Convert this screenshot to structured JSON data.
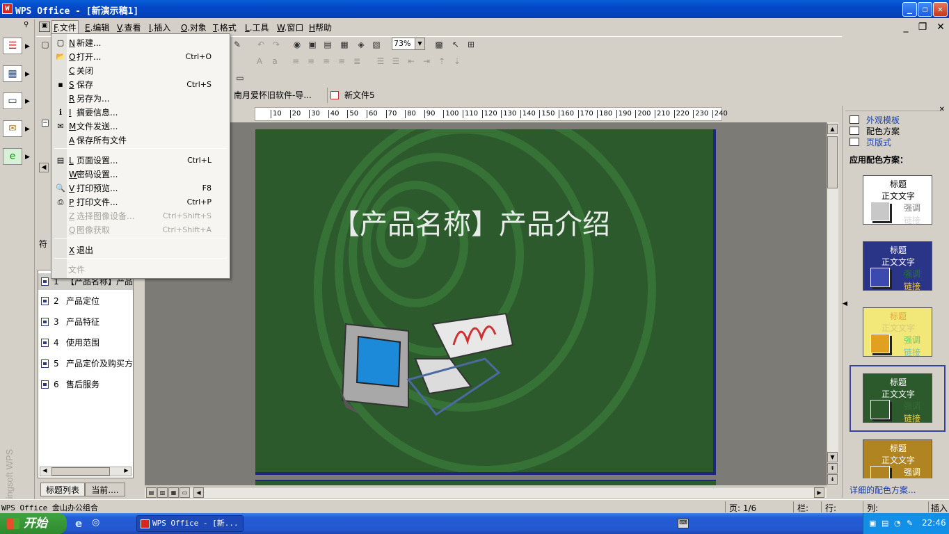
{
  "window": {
    "title": "WPS Office - [新演示稿1]",
    "controls": [
      "minimize",
      "maximize",
      "close"
    ]
  },
  "menubar": {
    "items": [
      {
        "key": "F",
        "label": ".文件"
      },
      {
        "key": "E",
        "label": ".编辑"
      },
      {
        "key": "V",
        "label": ".查看"
      },
      {
        "key": "I",
        "label": ".插入"
      },
      {
        "key": "O",
        "label": ".对象"
      },
      {
        "key": "T",
        "label": ".格式"
      },
      {
        "key": "L",
        "label": ".工具"
      },
      {
        "key": "W",
        "label": ".窗口"
      },
      {
        "key": "H",
        "label": "帮助"
      }
    ]
  },
  "file_menu": {
    "items": [
      {
        "key": "N",
        "label": "新建...",
        "shortcut": "",
        "icon": "new-file-icon"
      },
      {
        "key": "O",
        "label": "打开...",
        "shortcut": "Ctrl+O",
        "icon": "open-folder-icon"
      },
      {
        "key": "C",
        "label": "关闭",
        "shortcut": "",
        "icon": ""
      },
      {
        "key": "S",
        "label": "保存",
        "shortcut": "Ctrl+S",
        "icon": "save-icon"
      },
      {
        "key": "R",
        "label": "另存为...",
        "shortcut": "",
        "icon": ""
      },
      {
        "key": "I",
        "label": "摘要信息...",
        "shortcut": "",
        "icon": "info-icon"
      },
      {
        "key": "M",
        "label": "文件发送...",
        "shortcut": "",
        "icon": "mail-icon"
      },
      {
        "key": "A",
        "label": "保存所有文件",
        "shortcut": "",
        "icon": ""
      },
      {
        "key": "L",
        "label": "页面设置...",
        "shortcut": "Ctrl+L",
        "icon": "page-setup-icon"
      },
      {
        "key": "W",
        "label": "密码设置...",
        "shortcut": "",
        "icon": ""
      },
      {
        "key": "V",
        "label": "打印预览...",
        "shortcut": "F8",
        "icon": "print-preview-icon"
      },
      {
        "key": "P",
        "label": "打印文件...",
        "shortcut": "Ctrl+P",
        "icon": "printer-icon"
      },
      {
        "key": "Z",
        "label": "选择图像设备...",
        "shortcut": "Ctrl+Shift+S",
        "icon": ""
      },
      {
        "key": "Q",
        "label": "图像获取",
        "shortcut": "Ctrl+Shift+A",
        "icon": ""
      },
      {
        "key": "X",
        "label": "退出",
        "shortcut": "",
        "icon": ""
      }
    ],
    "recent_header": "文件"
  },
  "toolbar": {
    "zoom": "73%"
  },
  "doc_tabs": [
    {
      "label": "南月爱怀旧软件-导..."
    },
    {
      "label": "新文件5"
    }
  ],
  "outline": {
    "panel_label": "符",
    "items": [
      {
        "num": "1",
        "label": "【产品名称】产品"
      },
      {
        "num": "2",
        "label": "产品定位"
      },
      {
        "num": "3",
        "label": "产品特征"
      },
      {
        "num": "4",
        "label": "使用范围"
      },
      {
        "num": "5",
        "label": "产品定价及购买方"
      },
      {
        "num": "6",
        "label": "售后服务"
      }
    ],
    "tabs": [
      "标题列表",
      "当前...."
    ]
  },
  "ruler": {
    "ticks": [
      "10",
      "20",
      "30",
      "40",
      "50",
      "60",
      "70",
      "80",
      "90",
      "100",
      "110",
      "120",
      "130",
      "140",
      "150",
      "160",
      "170",
      "180",
      "190",
      "200",
      "210",
      "220",
      "230",
      "240"
    ]
  },
  "slide": {
    "title": "【产品名称】产品介绍",
    "background_color": "#2c5a2c"
  },
  "task_pane": {
    "links": [
      {
        "label": "外观模板",
        "icon": "template-icon"
      },
      {
        "label": "配色方案",
        "icon": "color-scheme-icon"
      },
      {
        "label": "页版式",
        "icon": "layout-icon"
      }
    ],
    "section_title": "应用配色方案：",
    "schemes": [
      {
        "title": "标题",
        "body": "正文文字",
        "accent": "强调",
        "link": "链接",
        "bg": "#ffffff",
        "title_color": "#000000",
        "body_color": "#000000",
        "accent_color": "#7a7a7a",
        "link_color": "#d8d8d8",
        "box_color": "#c8c8c8"
      },
      {
        "title": "标题",
        "body": "正文文字",
        "accent": "强调",
        "link": "链接",
        "bg": "#2a3588",
        "title_color": "#ffffff",
        "body_color": "#ffffff",
        "accent_color": "#1f7a2e",
        "link_color": "#f0c848",
        "box_color": "#3c4ab0"
      },
      {
        "title": "标题",
        "body": "正文文字",
        "accent": "强调",
        "link": "链接",
        "bg": "#f2e87a",
        "title_color": "#e8a63a",
        "body_color": "#d4c878",
        "accent_color": "#66cc66",
        "link_color": "#66cccc",
        "box_color": "#e0a020"
      },
      {
        "title": "标题",
        "body": "正文文字",
        "accent": "强调",
        "link": "链接",
        "bg": "#2c5a2c",
        "title_color": "#ffffff",
        "body_color": "#ffffff",
        "accent_color": "#356b35",
        "link_color": "#f0d048",
        "box_color": "#2c5a2c"
      },
      {
        "title": "标题",
        "body": "正文文字",
        "accent": "强调",
        "link": "",
        "bg": "#b08420",
        "title_color": "#ffffff",
        "body_color": "#ffffff",
        "accent_color": "#ffffff",
        "link_color": "#ffffff",
        "box_color": "#b08420"
      }
    ],
    "more_link": "详细的配色方案..."
  },
  "statusbar": {
    "app": "WPS Office 金山办公组合",
    "page": "页: 1/6",
    "column": "栏:",
    "row": "行:",
    "col2": "列:",
    "mode": "插入"
  },
  "taskbar": {
    "start": "开始",
    "task": "WPS Office - [新...",
    "clock": "22:46"
  },
  "launcher": {
    "brand": "Kingsoft WPS"
  }
}
